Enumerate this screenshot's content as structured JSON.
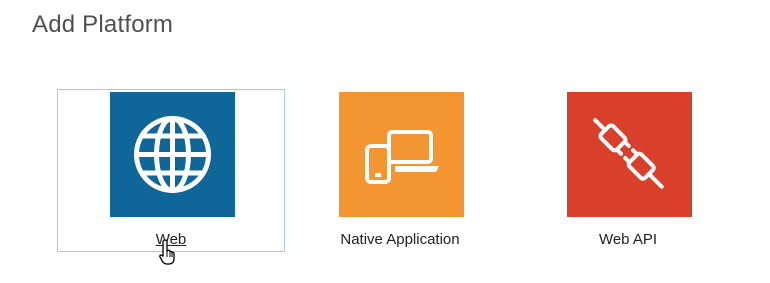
{
  "page": {
    "title": "Add Platform"
  },
  "platforms": [
    {
      "label": "Web",
      "icon": "globe-icon",
      "color": "#0e6699",
      "selected": true
    },
    {
      "label": "Native Application",
      "icon": "devices-icon",
      "color": "#f39530"
    },
    {
      "label": "Web API",
      "icon": "plug-icon",
      "color": "#d9402c"
    }
  ],
  "cursor": {
    "icon": "hand-pointer-icon"
  }
}
